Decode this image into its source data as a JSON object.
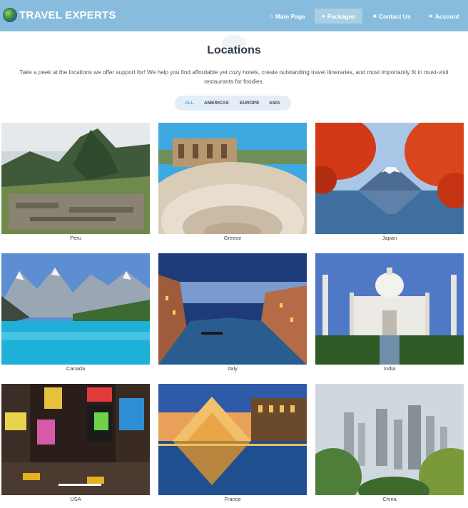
{
  "brand": {
    "name": "TRAVEL EXPERTS"
  },
  "nav": {
    "main": "Main Page",
    "packages": "Packages",
    "contact": "Contact Us",
    "account": "Account"
  },
  "page": {
    "title": "Locations",
    "intro": "Take a peek at the locations we offer support for! We help you find affordable yet cozy hotels, create outstanding travel itineraries, and most importantly fit in must-visit restaurants for foodies."
  },
  "filters": [
    "ALL",
    "AMERICAS",
    "EUROPE",
    "ASIA"
  ],
  "locations": [
    {
      "name": "Peru"
    },
    {
      "name": "Greece"
    },
    {
      "name": "Japan"
    },
    {
      "name": "Canada"
    },
    {
      "name": "Italy"
    },
    {
      "name": "India"
    },
    {
      "name": "USA"
    },
    {
      "name": "France"
    },
    {
      "name": "China"
    }
  ],
  "colors": {
    "navbar": "#87bcdc",
    "active_tab": "#a9cfe5",
    "filter_active": "#6ea6d6"
  }
}
